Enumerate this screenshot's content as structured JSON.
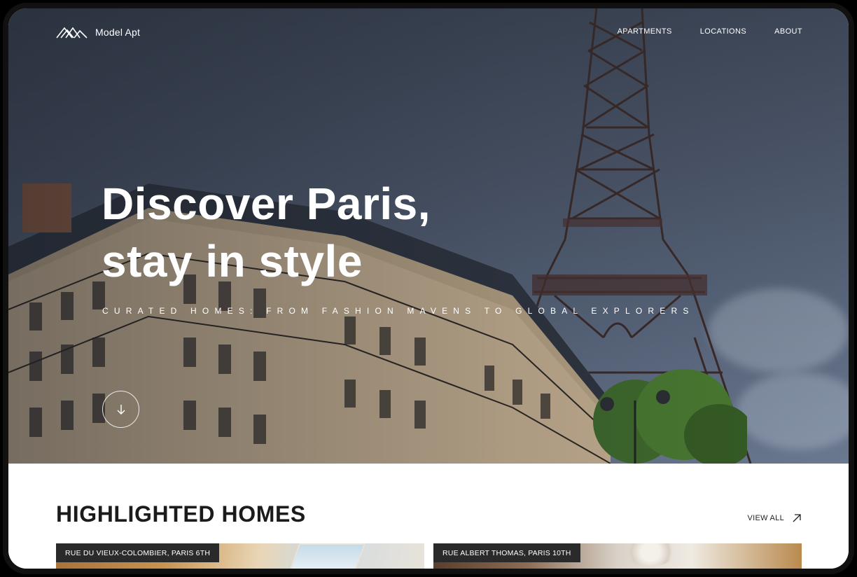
{
  "brand": {
    "name": "Model Apt",
    "logo_icon": "mountain-logo-icon"
  },
  "nav": {
    "items": [
      {
        "label": "APARTMENTS"
      },
      {
        "label": "LOCATIONS"
      },
      {
        "label": "ABOUT"
      }
    ]
  },
  "hero": {
    "headline_line1": "Discover Paris,",
    "headline_line2": "stay in style",
    "subtitle": "CURATED HOMES: FROM FASHION MAVENS TO GLOBAL EXPLORERS",
    "scroll_icon": "arrow-down-icon"
  },
  "highlighted": {
    "title": "HIGHLIGHTED HOMES",
    "view_all": "VIEW ALL",
    "view_all_icon": "arrow-up-right-icon",
    "cards": [
      {
        "tag": "RUE DU VIEUX-COLOMBIER, PARIS 6TH"
      },
      {
        "tag": "RUE ALBERT THOMAS, PARIS 10TH"
      }
    ]
  },
  "colors": {
    "overlay_text": "#ffffff",
    "heading": "#1b1b1b",
    "tag_bg": "#2a2a2a"
  }
}
